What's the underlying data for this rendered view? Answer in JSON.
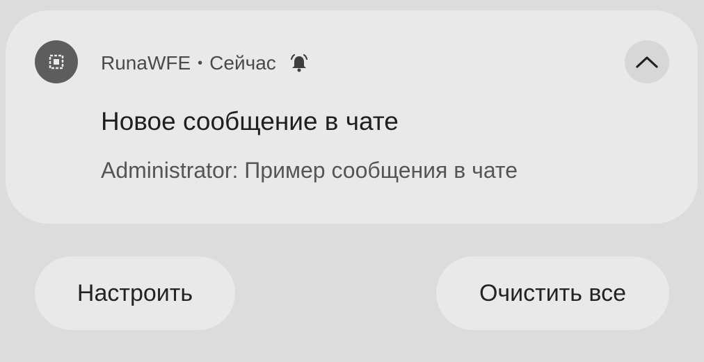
{
  "notification": {
    "app_name": "RunaWFE",
    "separator": "•",
    "time": "Сейчас",
    "title": "Новое сообщение в чате",
    "body": "Administrator: Пример сообщения в чате",
    "icons": {
      "app": "app-icon",
      "alert": "bell-alert-icon",
      "expand": "chevron-up-icon"
    }
  },
  "actions": {
    "configure_label": "Настроить",
    "clear_all_label": "Очистить все"
  },
  "colors": {
    "background": "#dcdcdc",
    "card": "#e9e9e9",
    "icon_bg": "#5d5d5d",
    "expand_bg": "#d7d7d7"
  }
}
